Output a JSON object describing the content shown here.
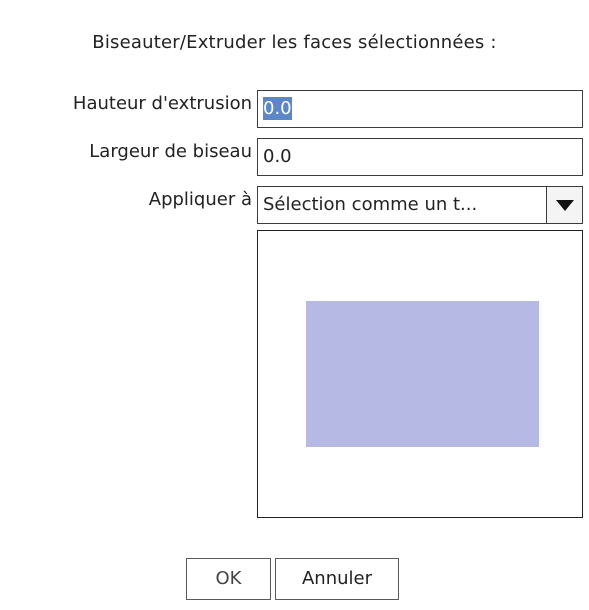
{
  "dialog": {
    "title": "Biseauter/Extruder les faces sélectionnées :",
    "fields": {
      "extrusion_height": {
        "label": "Hauteur d'extrusion",
        "value": "0.0",
        "selected": true
      },
      "bevel_width": {
        "label": "Largeur de biseau",
        "value": "0.0"
      },
      "apply_to": {
        "label": "Appliquer à",
        "value": "Sélection comme un t..."
      }
    },
    "preview": {
      "shape_color": "#b6b9e4"
    },
    "buttons": {
      "ok": "OK",
      "cancel": "Annuler"
    }
  },
  "icons": {
    "combo_arrow": "chevron-down-icon"
  }
}
